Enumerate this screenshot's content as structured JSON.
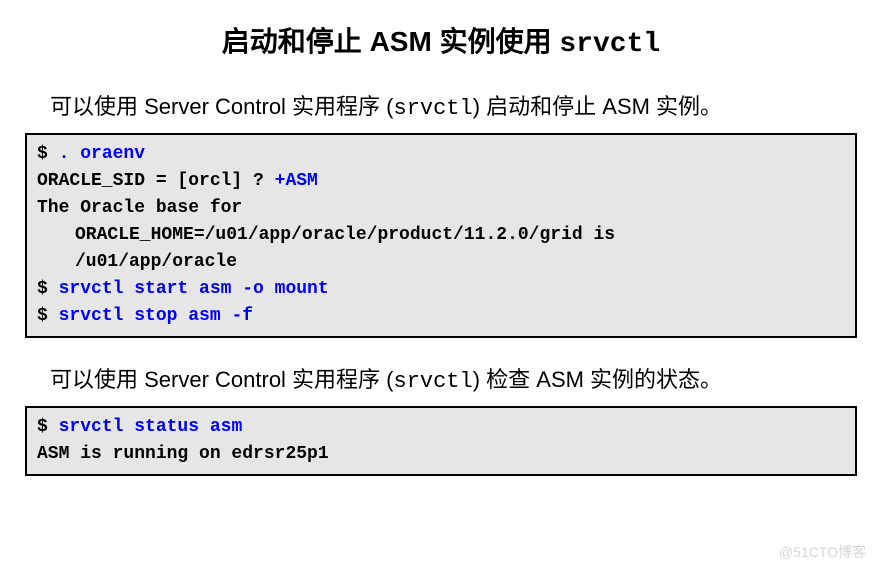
{
  "title": {
    "prefix": "启动和停止 ASM 实例使用 ",
    "code": "srvctl"
  },
  "desc1": {
    "part1": "可以使用 Server Control 实用程序 (",
    "code": "srvctl",
    "part2": ") 启动和停止 ASM 实例。"
  },
  "codeblock1": {
    "line1_prompt": "$ ",
    "line1_cmd": ". oraenv",
    "line2_text": "ORACLE_SID = [orcl] ? ",
    "line2_input": "+ASM",
    "line3": "The Oracle base for",
    "line4": "ORACLE_HOME=/u01/app/oracle/product/11.2.0/grid is",
    "line5": "/u01/app/oracle",
    "line6_prompt": "$ ",
    "line6_cmd": "srvctl start asm -o mount",
    "line7_prompt": "$ ",
    "line7_cmd": "srvctl stop asm -f"
  },
  "desc2": {
    "part1": "可以使用 Server Control 实用程序 (",
    "code": "srvctl",
    "part2": ") 检查 ASM 实例的状态。"
  },
  "codeblock2": {
    "line1_prompt": "$ ",
    "line1_cmd": "srvctl status asm",
    "line2": "ASM is running on edrsr25p1"
  },
  "watermark": "@51CTO博客"
}
